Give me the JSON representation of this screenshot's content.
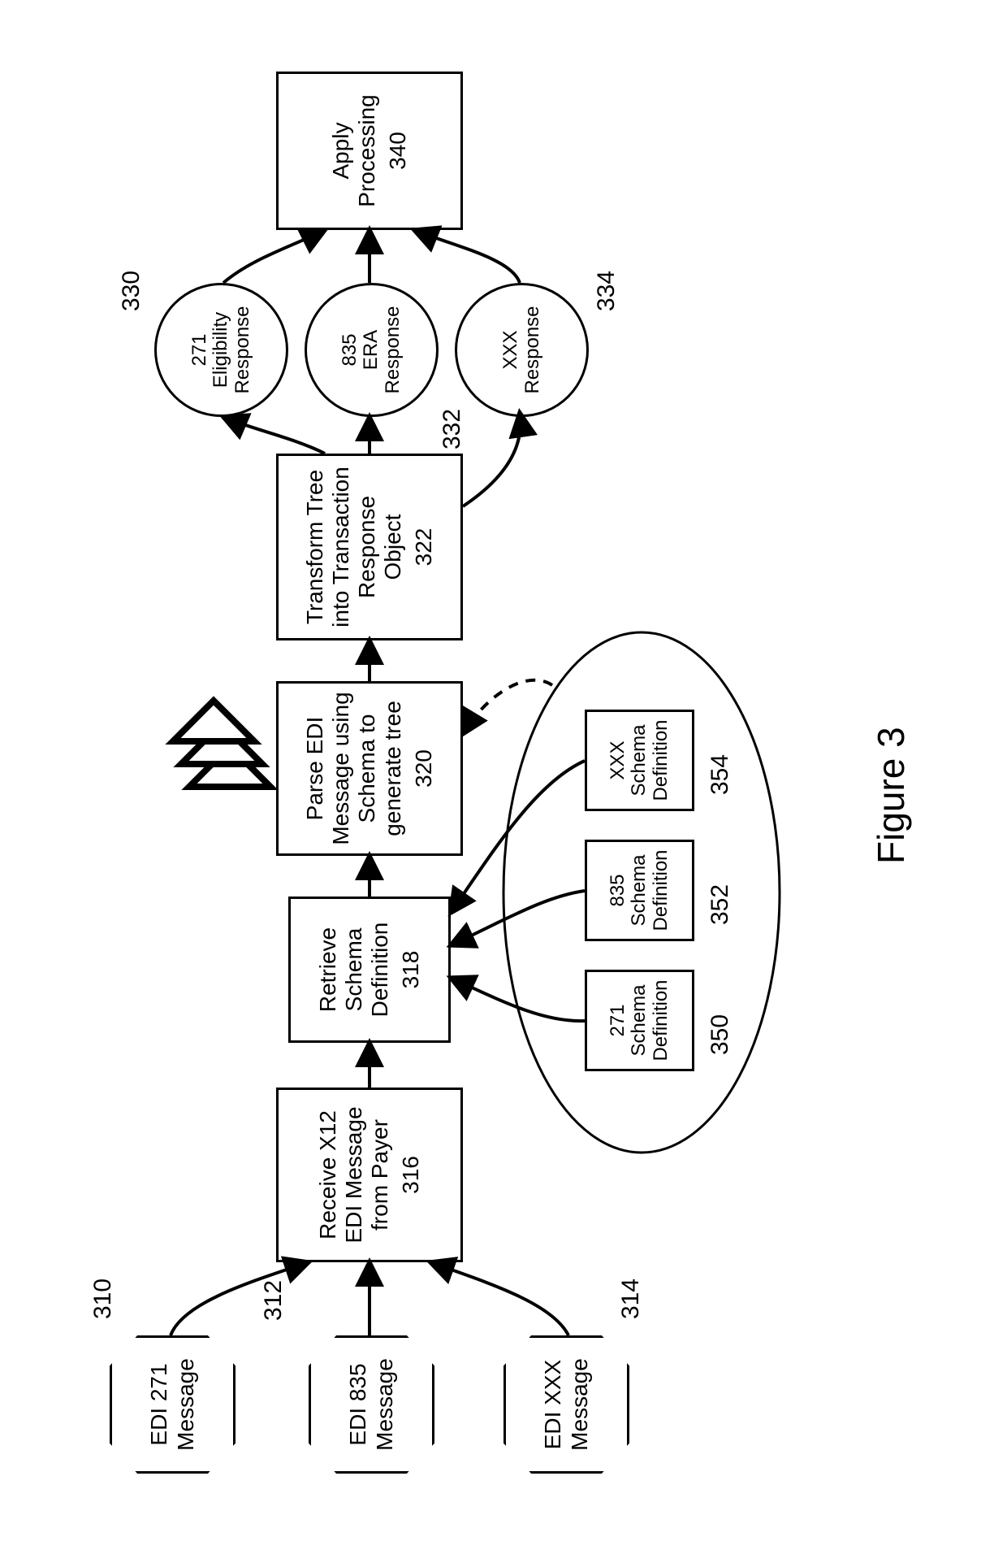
{
  "figure_caption": "Figure 3",
  "inputs": {
    "edi271": {
      "lines": [
        "EDI 271",
        "Message"
      ],
      "ref": "310"
    },
    "edi835": {
      "lines": [
        "EDI 835",
        "Message"
      ],
      "ref": "312"
    },
    "edixxx": {
      "lines": [
        "EDI XXX",
        "Message"
      ],
      "ref": "314"
    }
  },
  "steps": {
    "receive": {
      "lines": [
        "Receive X12",
        "EDI Message",
        "from Payer"
      ],
      "ref": "316"
    },
    "retrieve": {
      "lines": [
        "Retrieve",
        "Schema",
        "Definition"
      ],
      "ref": "318"
    },
    "parse": {
      "lines": [
        "Parse EDI",
        "Message using",
        "Schema to",
        "generate tree"
      ],
      "ref": "320"
    },
    "transform": {
      "lines": [
        "Transform Tree",
        "into Transaction",
        "Response",
        "Object"
      ],
      "ref": "322"
    },
    "apply": {
      "lines": [
        "Apply",
        "Processing"
      ],
      "ref": "340"
    }
  },
  "schemas": {
    "s271": {
      "lines": [
        "271",
        "Schema",
        "Definition"
      ],
      "ref": "350"
    },
    "s835": {
      "lines": [
        "835",
        "Schema",
        "Definition"
      ],
      "ref": "352"
    },
    "sxxx": {
      "lines": [
        "XXX",
        "Schema",
        "Definition"
      ],
      "ref": "354"
    }
  },
  "responses": {
    "r271": {
      "lines": [
        "271",
        "Eligibility",
        "Response"
      ],
      "ref": "330"
    },
    "r835": {
      "lines": [
        "835",
        "ERA",
        "Response"
      ],
      "ref": "332"
    },
    "rxxx": {
      "lines": [
        "XXX",
        "Response"
      ],
      "ref": "334"
    }
  }
}
